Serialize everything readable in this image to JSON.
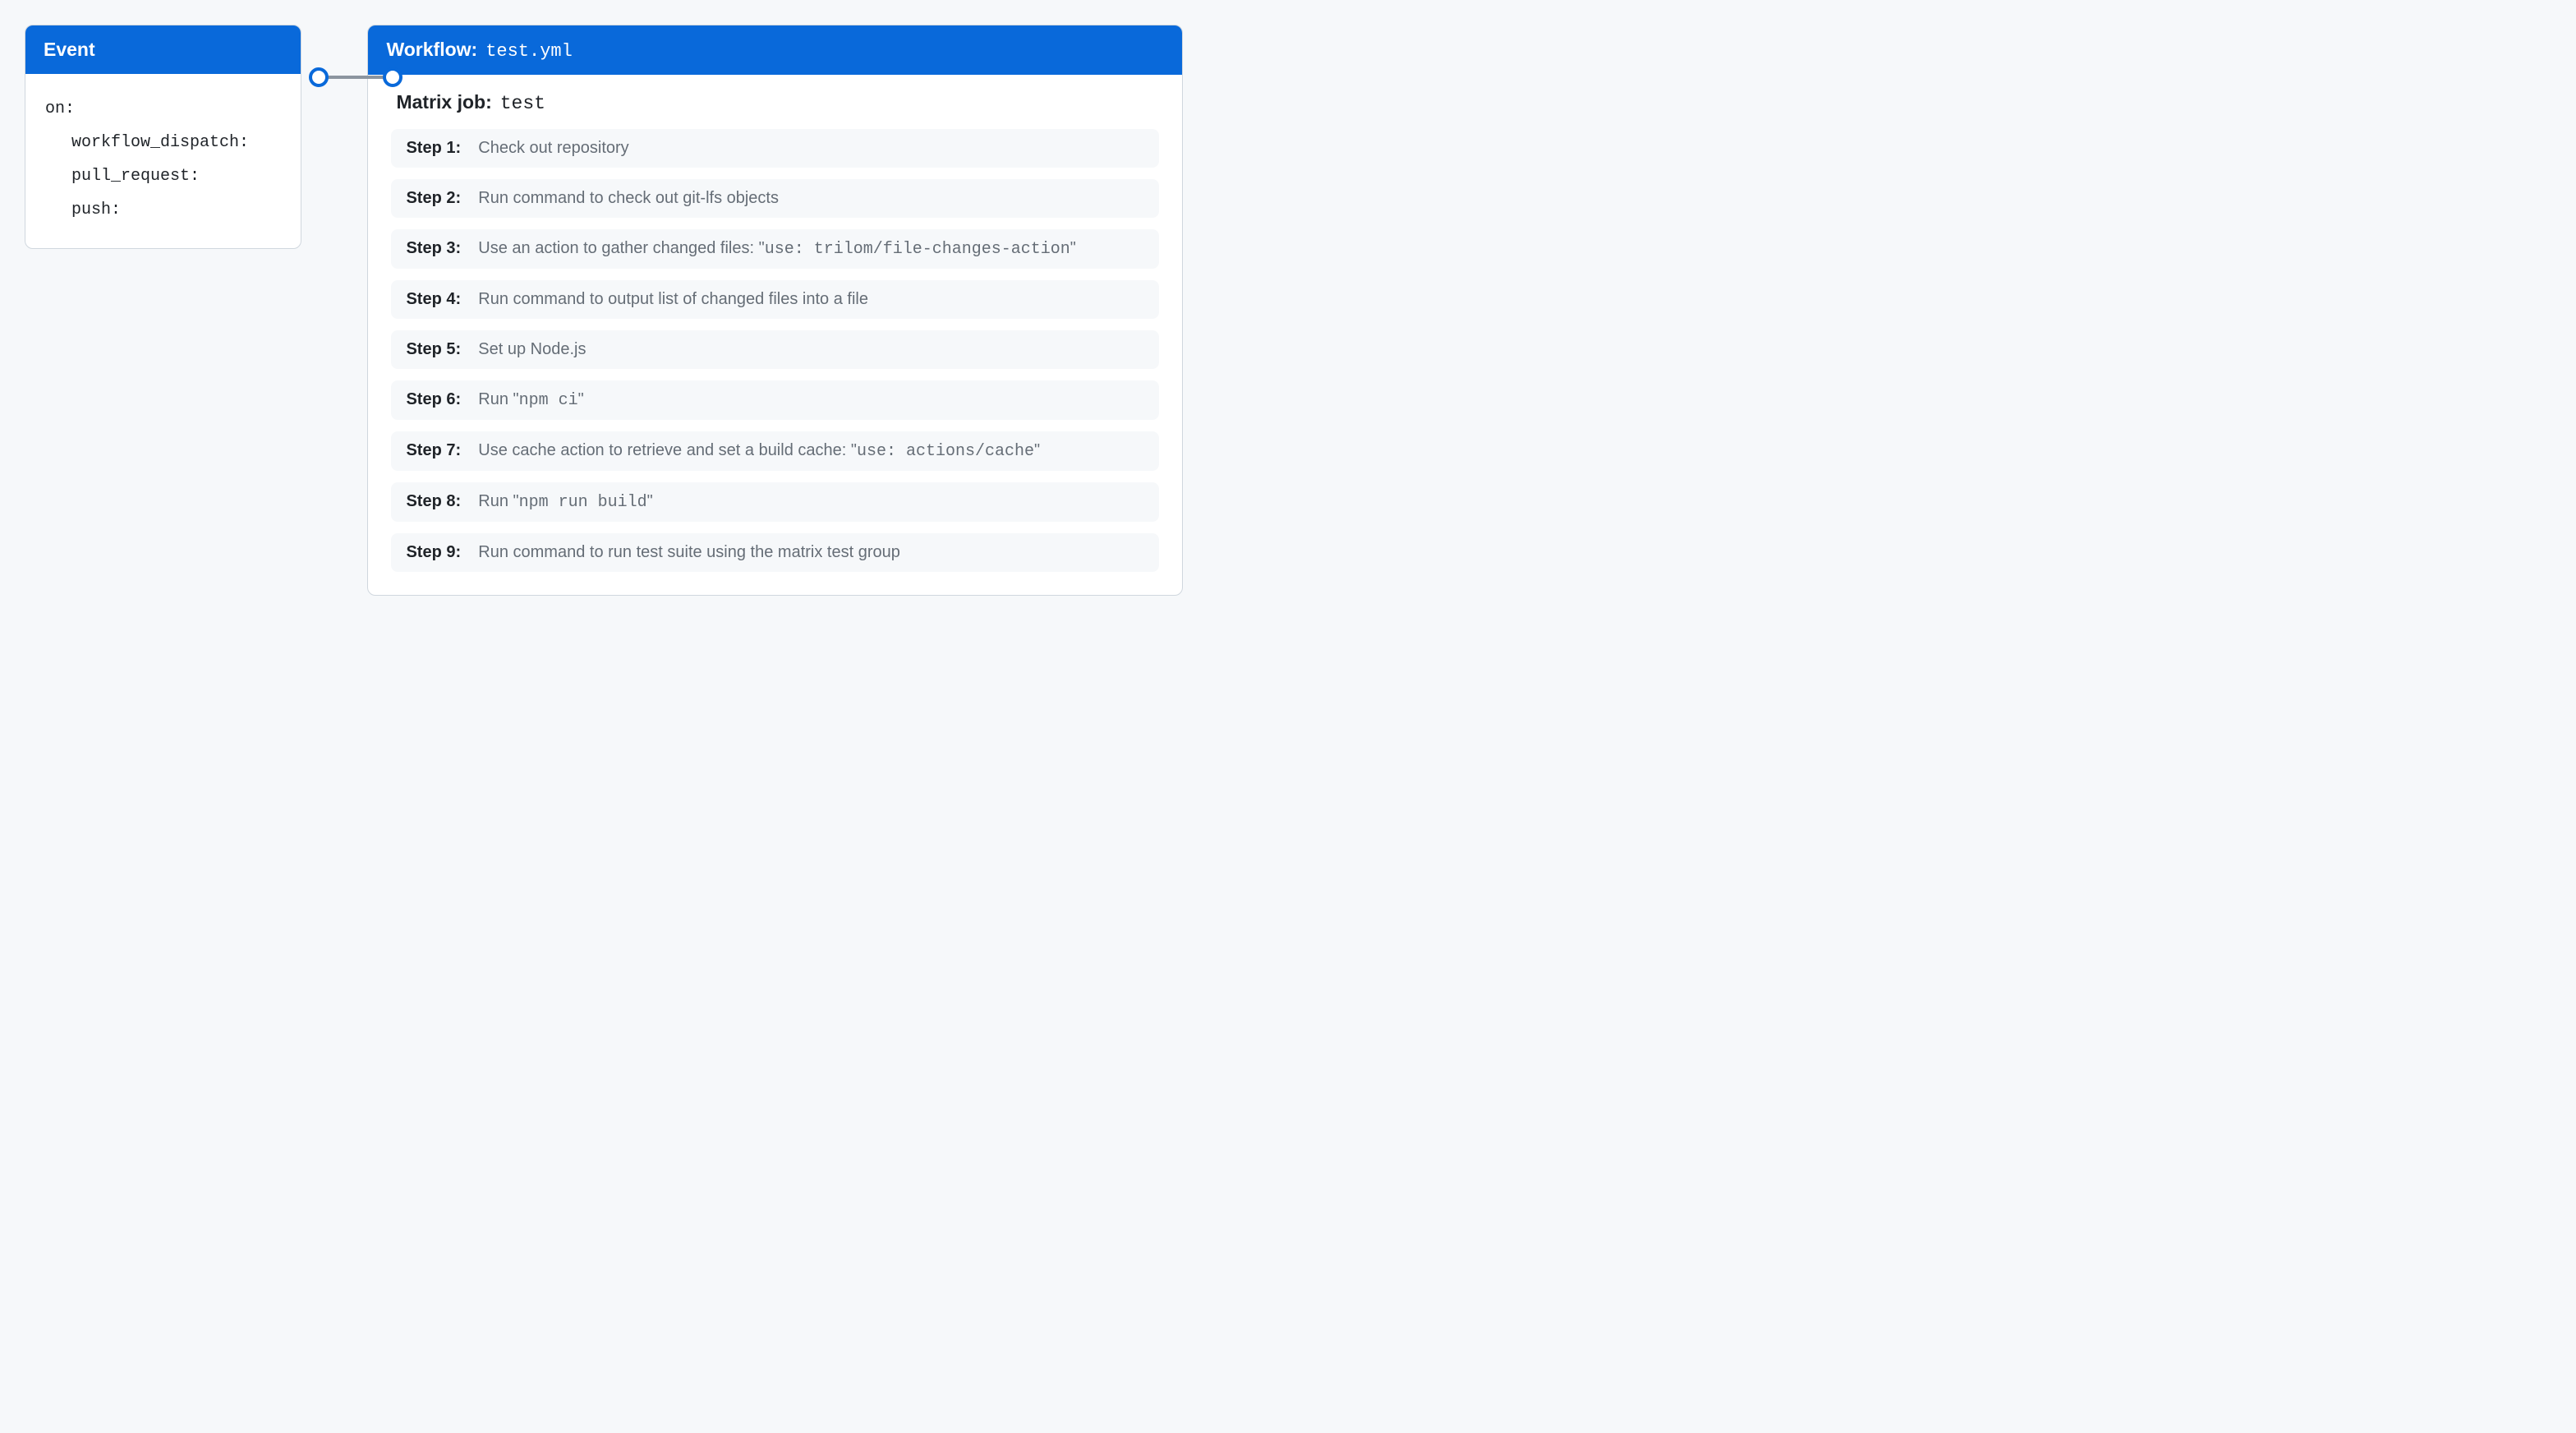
{
  "event": {
    "header": "Event",
    "yaml_root": "on:",
    "triggers": [
      "workflow_dispatch:",
      "pull_request:",
      "push:"
    ]
  },
  "workflow": {
    "header_label": "Workflow:",
    "header_filename": "test.yml",
    "job_label": "Matrix job:",
    "job_name": "test",
    "steps": [
      {
        "label": "Step 1:",
        "parts": [
          {
            "t": "text",
            "v": "Check out repository"
          }
        ]
      },
      {
        "label": "Step 2:",
        "parts": [
          {
            "t": "text",
            "v": "Run command to check out git-lfs objects"
          }
        ]
      },
      {
        "label": "Step 3:",
        "parts": [
          {
            "t": "text",
            "v": "Use an action to gather changed files: \""
          },
          {
            "t": "code",
            "v": "use: trilom/file-changes-action"
          },
          {
            "t": "text",
            "v": "\""
          }
        ]
      },
      {
        "label": "Step 4:",
        "parts": [
          {
            "t": "text",
            "v": "Run command to output list of changed files into a file"
          }
        ]
      },
      {
        "label": "Step 5:",
        "parts": [
          {
            "t": "text",
            "v": "Set up Node.js"
          }
        ]
      },
      {
        "label": "Step 6:",
        "parts": [
          {
            "t": "text",
            "v": "Run \""
          },
          {
            "t": "code",
            "v": "npm ci"
          },
          {
            "t": "text",
            "v": "\""
          }
        ]
      },
      {
        "label": "Step 7:",
        "parts": [
          {
            "t": "text",
            "v": "Use cache action to retrieve and set a build cache: \""
          },
          {
            "t": "code",
            "v": "use: actions/cache"
          },
          {
            "t": "text",
            "v": "\""
          }
        ]
      },
      {
        "label": "Step 8:",
        "parts": [
          {
            "t": "text",
            "v": "Run \""
          },
          {
            "t": "code",
            "v": "npm run build"
          },
          {
            "t": "text",
            "v": "\""
          }
        ]
      },
      {
        "label": "Step 9:",
        "parts": [
          {
            "t": "text",
            "v": "Run command to run test suite using the matrix test group"
          }
        ]
      }
    ]
  }
}
